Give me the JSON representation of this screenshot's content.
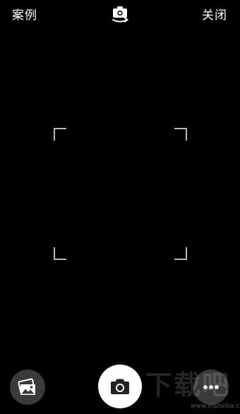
{
  "top_bar": {
    "examples_label": "案例",
    "close_label": "关闭",
    "switch_camera_icon": "camera-switch-icon"
  },
  "scan_frame": {
    "corner_color": "#b8b8b8"
  },
  "bottom_bar": {
    "gallery_icon": "gallery-icon",
    "shutter_icon": "camera-icon",
    "more_icon": "more-dots-icon"
  },
  "watermark": {
    "logo_text": "下载吧",
    "url_text": "www.xiazaiba.com"
  }
}
